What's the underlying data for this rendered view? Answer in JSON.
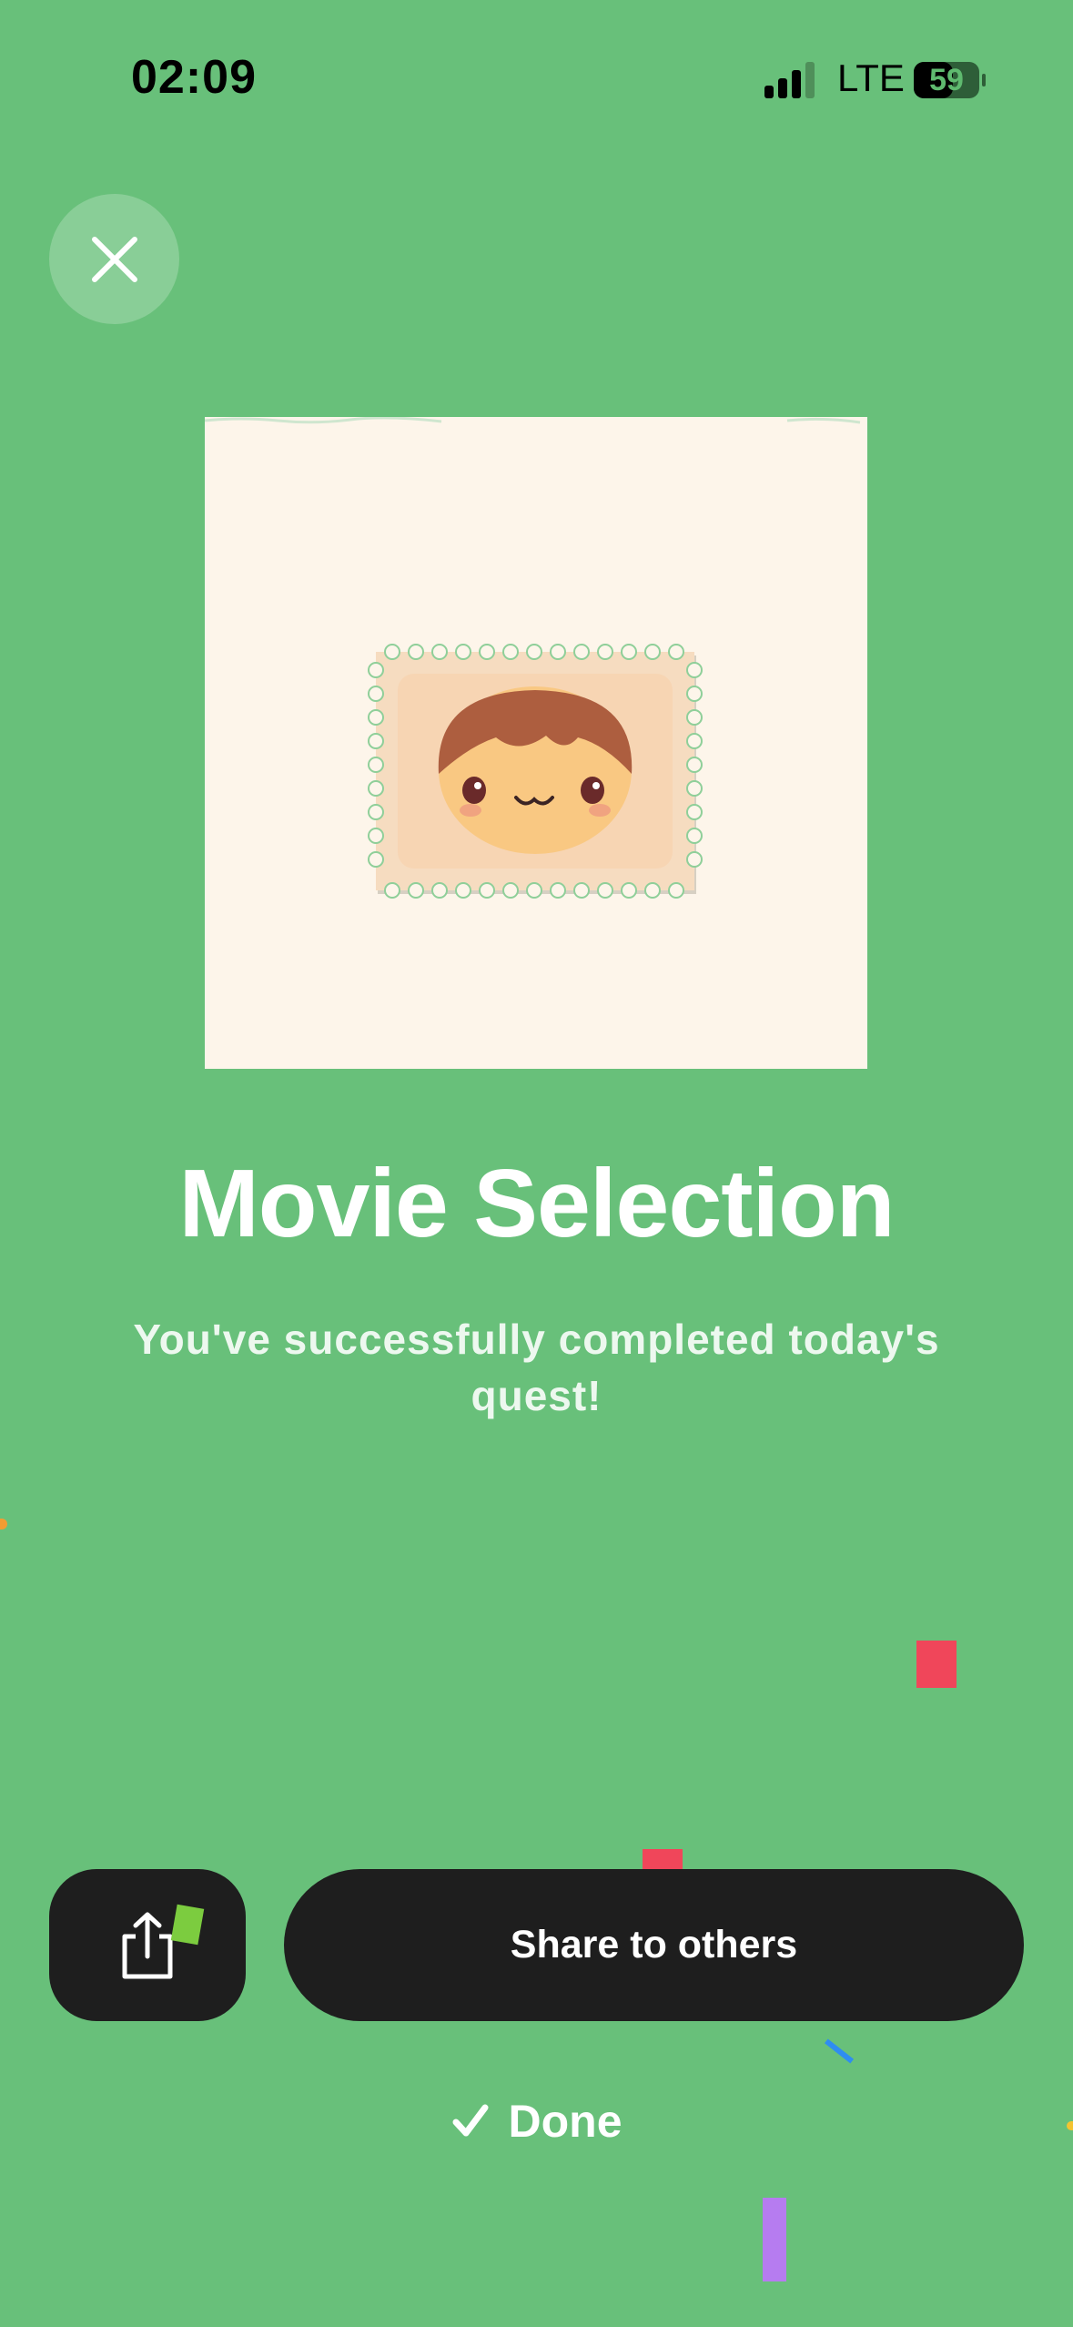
{
  "status_bar": {
    "time": "02:09",
    "network": "LTE",
    "battery": "59"
  },
  "close": {
    "icon": "close-icon"
  },
  "quest": {
    "title": "Movie Selection",
    "message": "You've successfully completed today's quest!"
  },
  "actions": {
    "share_icon": "share-icon",
    "share_label": "Share to others",
    "done_label": "Done"
  },
  "colors": {
    "background": "#68c07a",
    "card": "#fdf5ea",
    "button": "#1e1e1e",
    "text": "#ffffff"
  }
}
